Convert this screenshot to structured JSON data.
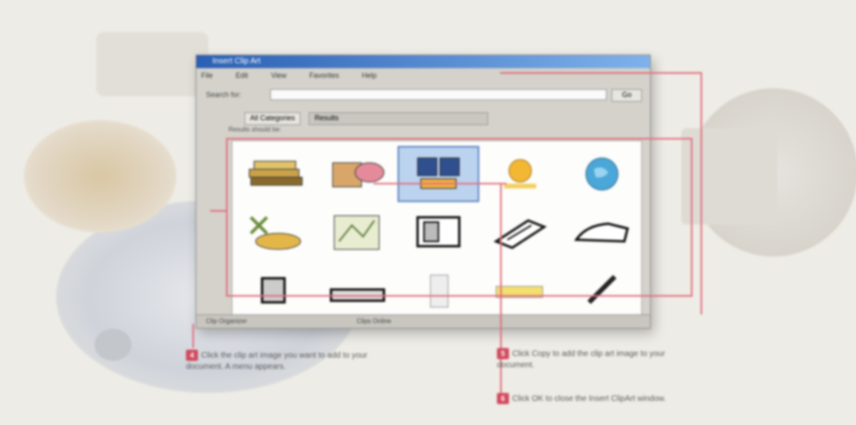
{
  "window": {
    "title": "Insert Clip Art",
    "menu": [
      "File",
      "Edit",
      "View",
      "Favorites",
      "Help"
    ],
    "search_label": "Search for:",
    "search_value": "",
    "go_label": "Go",
    "tabs": [
      "All Categories",
      "Results"
    ],
    "results_label": "Results should be:",
    "status_left": "Clip Organizer",
    "status_right": "Clips Online"
  },
  "clip_thumbs": [
    "books-clip",
    "globe-clip",
    "monitor-clip",
    "sun-clip",
    "earth-clip",
    "papers-clip",
    "map-clip",
    "computer-clip",
    "stapler-clip",
    "shoe-clip",
    "printer-clip",
    "scanner-clip",
    "folder-clip",
    "pencil-clip",
    "pen-clip"
  ],
  "steps": {
    "step1": {
      "number": "4",
      "text": "Click the clip art image you want to add to your document. A menu appears."
    },
    "step2": {
      "number": "5",
      "text": "Click Copy to add the clip art image to your document."
    },
    "step3": {
      "number": "6",
      "text": "Click OK to close the Insert ClipArt window."
    }
  },
  "colors": {
    "accent": "#e06e7e",
    "titlebar": "#2a5fb4",
    "badge": "#d14a5d"
  }
}
